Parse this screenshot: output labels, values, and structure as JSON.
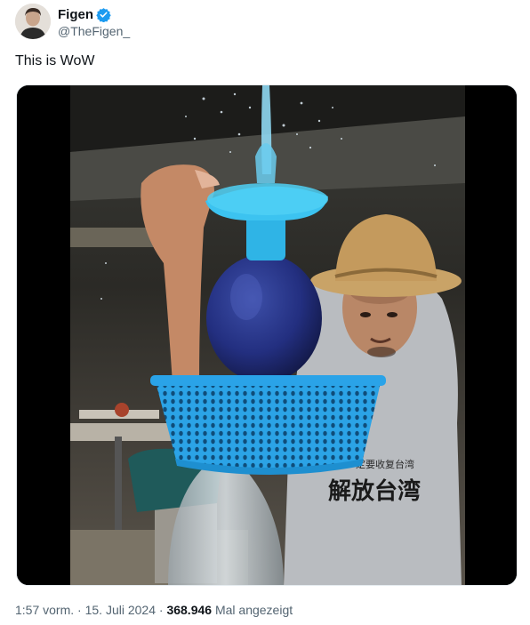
{
  "author": {
    "name": "Figen",
    "handle": "@TheFigen_",
    "verified_color": "#1d9bf0"
  },
  "tweet": {
    "text": "This is WoW"
  },
  "media": {
    "type": "video",
    "shirt_text_top": "一定要收复台湾",
    "shirt_text_main": "解放台湾"
  },
  "meta": {
    "time": "1:57 vorm.",
    "separator": "·",
    "date": "15. Juli 2024",
    "views": "368.946",
    "views_label": "Mal angezeigt"
  }
}
